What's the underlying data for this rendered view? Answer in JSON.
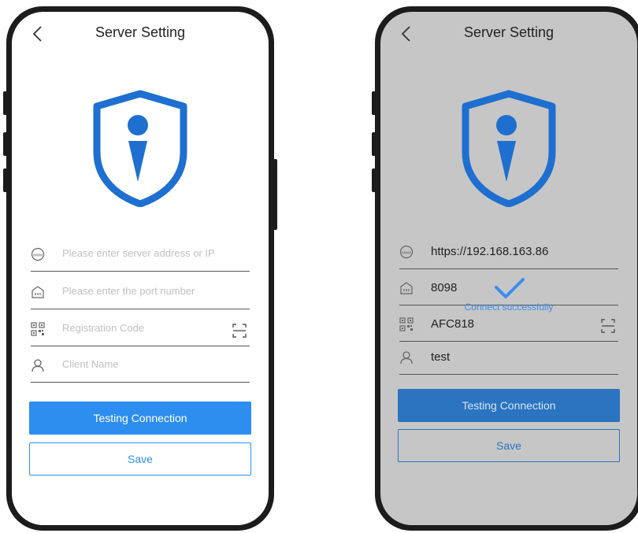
{
  "colors": {
    "accent": "#2d8ef0",
    "shield": "#1e6fd0",
    "dim_background": "#c6c6c6"
  },
  "left_screen": {
    "title": "Server Setting",
    "fields": [
      {
        "icon": "server-address-icon",
        "placeholder": "Please enter server address or IP",
        "value": ""
      },
      {
        "icon": "port-icon",
        "placeholder": "Please enter the port number",
        "value": ""
      },
      {
        "icon": "qr-code-icon",
        "placeholder": "Registration Code",
        "value": "",
        "scan_icon": "scan-icon"
      },
      {
        "icon": "user-icon",
        "placeholder": "Client Name",
        "value": ""
      }
    ],
    "test_button": "Testing Connection",
    "save_button": "Save"
  },
  "right_screen": {
    "title": "Server Setting",
    "fields": [
      {
        "icon": "server-address-icon",
        "value": "https://192.168.163.86"
      },
      {
        "icon": "port-icon",
        "value": "8098"
      },
      {
        "icon": "qr-code-icon",
        "value": "AFC818",
        "scan_icon": "scan-icon"
      },
      {
        "icon": "user-icon",
        "value": "test"
      }
    ],
    "success_message": "Connect successfully",
    "success_icon": "checkmark-icon",
    "test_button": "Testing Connection",
    "save_button": "Save"
  }
}
